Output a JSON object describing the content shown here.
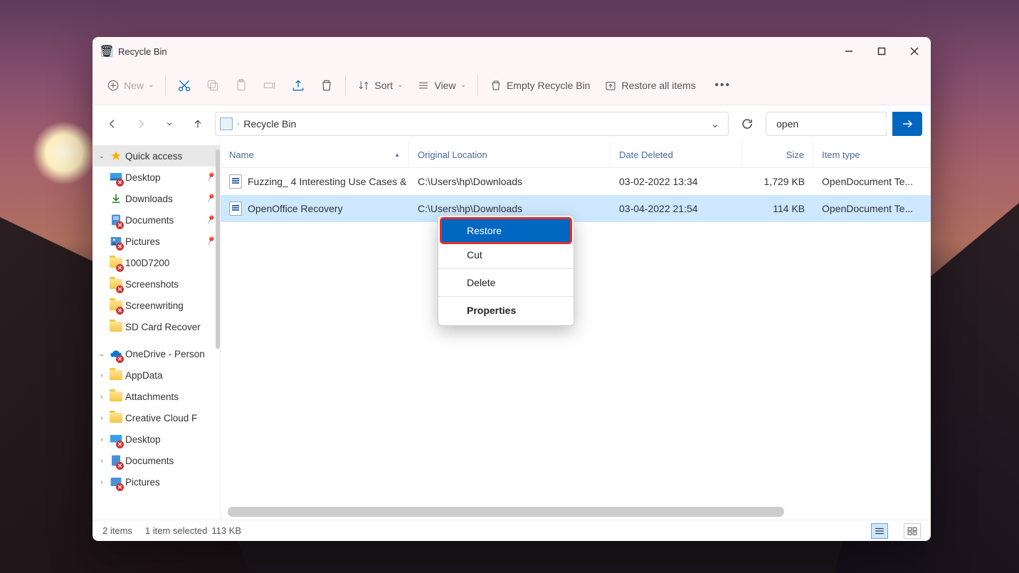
{
  "title": "Recycle Bin",
  "toolbar": {
    "new": "New",
    "sort": "Sort",
    "view": "View",
    "empty": "Empty Recycle Bin",
    "restore_all": "Restore all items"
  },
  "breadcrumb": {
    "root": "Recycle Bin"
  },
  "search": {
    "value": "open"
  },
  "columns": {
    "name": "Name",
    "location": "Original Location",
    "date": "Date Deleted",
    "size": "Size",
    "type": "Item type"
  },
  "rows": [
    {
      "name": "Fuzzing_ 4 Interesting Use Cases & ...",
      "location": "C:\\Users\\hp\\Downloads",
      "date": "03-02-2022 13:34",
      "size": "1,729 KB",
      "type": "OpenDocument Te..."
    },
    {
      "name": "OpenOffice Recovery",
      "location": "C:\\Users\\hp\\Downloads",
      "date": "03-04-2022 21:54",
      "size": "114 KB",
      "type": "OpenDocument Te..."
    }
  ],
  "context": {
    "restore": "Restore",
    "cut": "Cut",
    "delete": "Delete",
    "properties": "Properties"
  },
  "sidebar": {
    "quick": "Quick access",
    "qa": [
      "Desktop",
      "Downloads",
      "Documents",
      "Pictures",
      "100D7200",
      "Screenshots",
      "Screenwriting",
      "SD Card Recover"
    ],
    "onedrive": "OneDrive - Person",
    "od": [
      "AppData",
      "Attachments",
      "Creative Cloud F",
      "Desktop",
      "Documents",
      "Pictures"
    ]
  },
  "status": {
    "count": "2 items",
    "selected": "1 item selected",
    "size": "113 KB"
  }
}
